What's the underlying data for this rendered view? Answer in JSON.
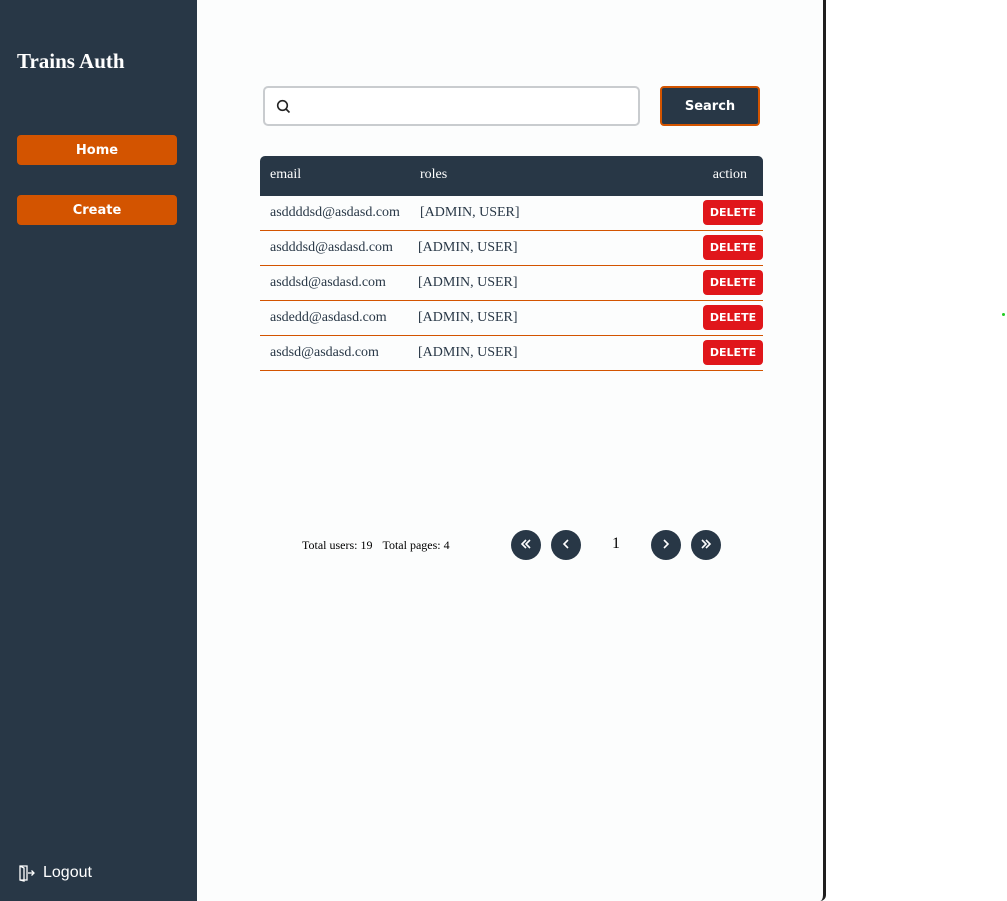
{
  "sidebar": {
    "brand": "Trains Auth",
    "items": [
      {
        "label": "Home"
      },
      {
        "label": "Create"
      }
    ],
    "logout_label": "Logout"
  },
  "search": {
    "placeholder": "",
    "value": "",
    "button_label": "Search"
  },
  "table": {
    "headers": {
      "email": "email",
      "roles": "roles",
      "action": "action"
    },
    "rows": [
      {
        "email": "asddddsd@asdasd.com",
        "roles": "[ADMIN, USER]",
        "action": "DELETE"
      },
      {
        "email": "asdddsd@asdasd.com",
        "roles": "[ADMIN, USER]",
        "action": "DELETE"
      },
      {
        "email": "asddsd@asdasd.com",
        "roles": "[ADMIN, USER]",
        "action": "DELETE"
      },
      {
        "email": "asdedd@asdasd.com",
        "roles": "[ADMIN, USER]",
        "action": "DELETE"
      },
      {
        "email": "asdsd@asdasd.com",
        "roles": "[ADMIN, USER]",
        "action": "DELETE"
      }
    ]
  },
  "pagination": {
    "total_users": "Total users: 19",
    "total_pages": "Total pages: 4",
    "current_page": "1"
  },
  "icons": {
    "search": "search-icon",
    "logout": "logout-icon",
    "first": "double-chevron-left-icon",
    "prev": "chevron-left-icon",
    "next": "chevron-right-icon",
    "last": "double-chevron-right-icon"
  },
  "colors": {
    "sidebar": "#283746",
    "accent": "#d35400",
    "danger": "#e0161b",
    "background": "#fcfdfd"
  }
}
